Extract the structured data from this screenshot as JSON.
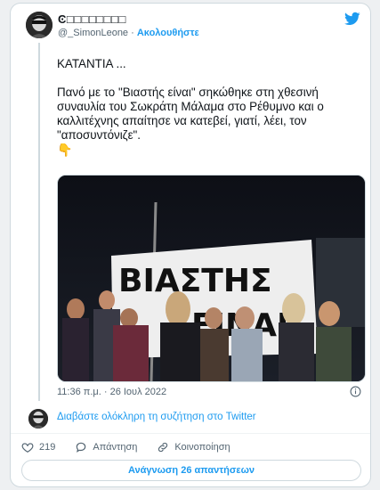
{
  "author": {
    "display_name": "Ͼ□□□□□□□□",
    "handle": "@_SimonLeone",
    "separator": "·",
    "follow_label": "Ακολουθήστε"
  },
  "tweet": {
    "line1": "ΚΑΤΑΝΤΙΑ ...",
    "line2": "Πανό με το \"Βιαστής είναι\" σηκώθηκε στη χθεσινή συναυλία του Σωκράτη Μάλαμα στο Ρέθυμνο και ο καλλιτέχνης απαίτησε να κατεβεί, γιατί, λέει, τον \"αποσυντόνιζε\".",
    "emoji": "👇",
    "banner_line1": "ΒΙΑΣΤΗΣ",
    "banner_line2": "ΕΙΝΑΙ",
    "timestamp": "11:36 π.μ. · 26 Ιουλ 2022"
  },
  "footer": {
    "read_thread": "Διαβάστε ολόκληρη τη συζήτηση στο Twitter",
    "like_count": "219",
    "reply_label": "Απάντηση",
    "share_label": "Κοινοποίηση",
    "read_replies_label": "Ανάγνωση 26 απαντήσεων"
  },
  "colors": {
    "accent": "#1d9bf0",
    "text": "#0f1419",
    "muted": "#536471"
  },
  "icons": [
    "twitter-bird-icon",
    "info-icon",
    "heart-icon",
    "reply-bubble-icon",
    "link-icon",
    "pointing-down-emoji"
  ]
}
